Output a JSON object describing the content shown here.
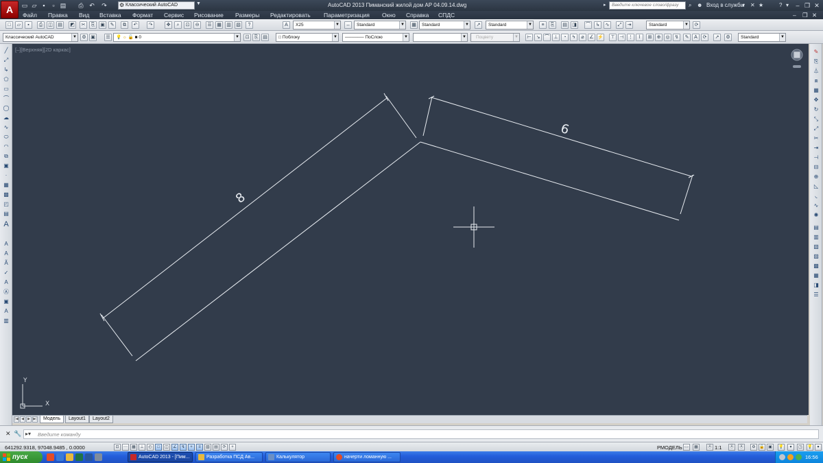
{
  "app": {
    "title": "AutoCAD 2013   Пиманский жилой дом АР 04.09.14.dwg",
    "app_button": "A",
    "workspace": "Классический AutoCAD",
    "search_placeholder": "Введите ключевое слово/фразу",
    "signin": "Вход в службы",
    "help": "?"
  },
  "menu": [
    "Файл",
    "Правка",
    "Вид",
    "Вставка",
    "Формат",
    "Сервис",
    "Рисование",
    "Размеры",
    "Редактировать",
    "Параметризация",
    "Окно",
    "Справка",
    "СПДС"
  ],
  "toolbar": {
    "text_style": "X25",
    "dim_style": "Standard",
    "table_style": "Standard",
    "mleader_style": "Standard",
    "workspace2": "Классический AutoCAD",
    "layer": "0",
    "color": "Поблоку",
    "linetype": "ПоСлою",
    "lineweight": "",
    "plotstyle": "Поцвету",
    "dim_style2": "Standard",
    "mleader_style2": "Standard"
  },
  "viewport": {
    "label_controls": "[–][Верхняя][2D каркас]",
    "dimensions": [
      {
        "value": "8"
      },
      {
        "value": "6"
      }
    ],
    "ucs_x": "X",
    "ucs_y": "Y"
  },
  "tabs": [
    "Модель",
    "Layout1",
    "Layout2"
  ],
  "command": {
    "placeholder": "Введите команду"
  },
  "status": {
    "coords": "641292.9318, 97048.9485 , 0.0000",
    "model": "РМОДЕЛЬ",
    "annotation_scale": "1:1"
  },
  "taskbar": {
    "start": "пуск",
    "tasks": [
      {
        "label": "AutoCAD 2013 - [Пим...",
        "active": true,
        "color": "#c62828"
      },
      {
        "label": "Разработка ПСД Ав...",
        "active": false,
        "color": "#e7b93e"
      },
      {
        "label": "Калькулятор",
        "active": false,
        "color": "#6b8fc4"
      },
      {
        "label": "начерти ломанную ...",
        "active": false,
        "color": "#e34c26"
      }
    ],
    "clock": "16:56"
  },
  "colors": {
    "canvas": "#323c4b",
    "line": "#e9edf2",
    "title_bg": "#2b3542",
    "taskbar": "#245edb",
    "start": "#3c9a3a"
  }
}
